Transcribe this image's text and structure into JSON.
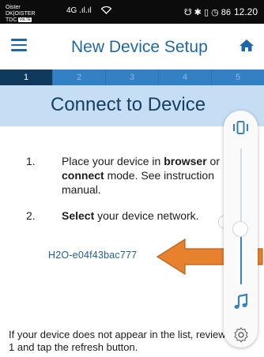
{
  "status_bar": {
    "carrier_line1": "Oister DK|OISTER",
    "carrier_line2": "TDC",
    "carrier_badge": "VoLTE",
    "signal1": "4G .ıl",
    "signal2": ".ıl",
    "indicators": "☋ ✱ ▯ ◷ 86",
    "time": "12.20"
  },
  "app_bar": {
    "title": "New Device Setup",
    "menu_icon": "hamburger-icon",
    "home_icon": "home-icon"
  },
  "stepper": {
    "steps": [
      "1",
      "2",
      "3",
      "4",
      "5"
    ],
    "active_step": 1
  },
  "section": {
    "title": "Connect to Device"
  },
  "instructions": [
    {
      "number": "1.",
      "parts": [
        {
          "text": "Place your device in ",
          "bold": false
        },
        {
          "text": "browser",
          "bold": true
        },
        {
          "text": " or ",
          "bold": false
        },
        {
          "text": "connect",
          "bold": true
        },
        {
          "text": " mode. See instruction manual.",
          "bold": false
        }
      ]
    },
    {
      "number": "2.",
      "parts": [
        {
          "text": "Select",
          "bold": true
        },
        {
          "text": " your device network.",
          "bold": false
        }
      ]
    }
  ],
  "network": {
    "ssid": "H2O-e04f43bac777"
  },
  "footer": {
    "note": "If your device does not appear in the list, review step 1 and tap the refresh button."
  },
  "side_panel": {
    "icons": [
      "vibrate-icon",
      "music-icon",
      "settings-icon"
    ],
    "accent": "#3a7fc0"
  },
  "colors": {
    "primary": "#1f67a3",
    "step_active": "#10395e",
    "step_inactive": "#3380c4",
    "header_bg": "#c6def3",
    "arrow": "#e8812e"
  }
}
